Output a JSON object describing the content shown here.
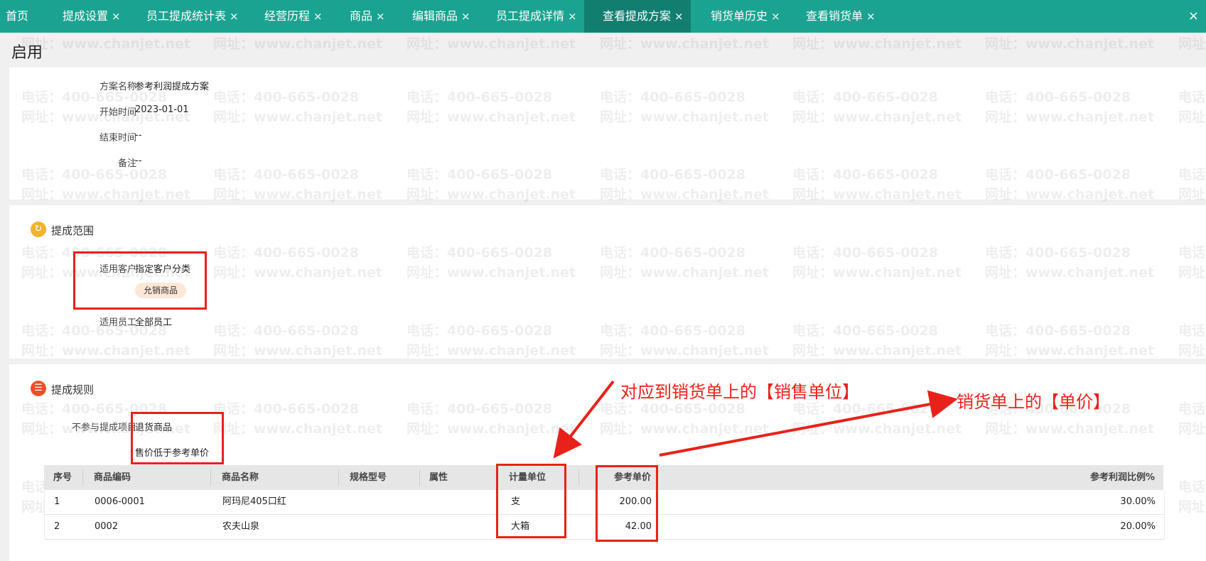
{
  "tabs": [
    {
      "label": "首页",
      "close": ""
    },
    {
      "label": "提成设置",
      "close": "×"
    },
    {
      "label": "员工提成统计表",
      "close": "×"
    },
    {
      "label": "经营历程",
      "close": "×"
    },
    {
      "label": "商品",
      "close": "×"
    },
    {
      "label": "编辑商品",
      "close": "×"
    },
    {
      "label": "员工提成详情",
      "close": "×"
    },
    {
      "label": "查看提成方案",
      "close": "×"
    },
    {
      "label": "销货单历史",
      "close": "×"
    },
    {
      "label": "查看销货单",
      "close": "×"
    }
  ],
  "window_close": "×",
  "status_title": "启用",
  "plan_info": {
    "name_label": "方案名称",
    "name_value": "参考利润提成方案",
    "start_label": "开始时间",
    "start_value": "2023-01-01",
    "end_label": "结束时间",
    "end_value": "--",
    "note_label": "备注",
    "note_value": "--"
  },
  "scope": {
    "title": "提成范围",
    "customer_label": "适用客户",
    "customer_value": "指定客户分类",
    "customer_tag": "允销商品",
    "employee_label": "适用员工",
    "employee_value": "全部员工"
  },
  "rules": {
    "title": "提成规则",
    "exclude_label": "不参与提成项目",
    "exclude_items": [
      "退货商品",
      "售价低于参考单价"
    ]
  },
  "table": {
    "columns": [
      "序号",
      "商品编码",
      "商品名称",
      "规格型号",
      "属性",
      "计量单位",
      "参考单价",
      "参考利润比例%"
    ],
    "rows": [
      {
        "no": "1",
        "code": "0006-0001",
        "name": "阿玛尼405口红",
        "spec": "",
        "attr": "",
        "unit": "支",
        "price": "200.00",
        "ratio": "30.00%"
      },
      {
        "no": "2",
        "code": "0002",
        "name": "农夫山泉",
        "spec": "",
        "attr": "",
        "unit": "大箱",
        "price": "42.00",
        "ratio": "20.00%"
      }
    ]
  },
  "annotations": {
    "unit_note": "对应到销货单上的【销售单位】",
    "price_note": "销货单上的【单价】"
  },
  "watermark": {
    "phone": "电话：400-665-0028",
    "site": "网址：www.chanjet.net"
  },
  "colors": {
    "tab_bar": "#1aa391",
    "tab_active": "#127e70",
    "annotation_red": "#e8221a",
    "scope_icon": "#f0b42e",
    "rules_icon": "#e8502a"
  }
}
